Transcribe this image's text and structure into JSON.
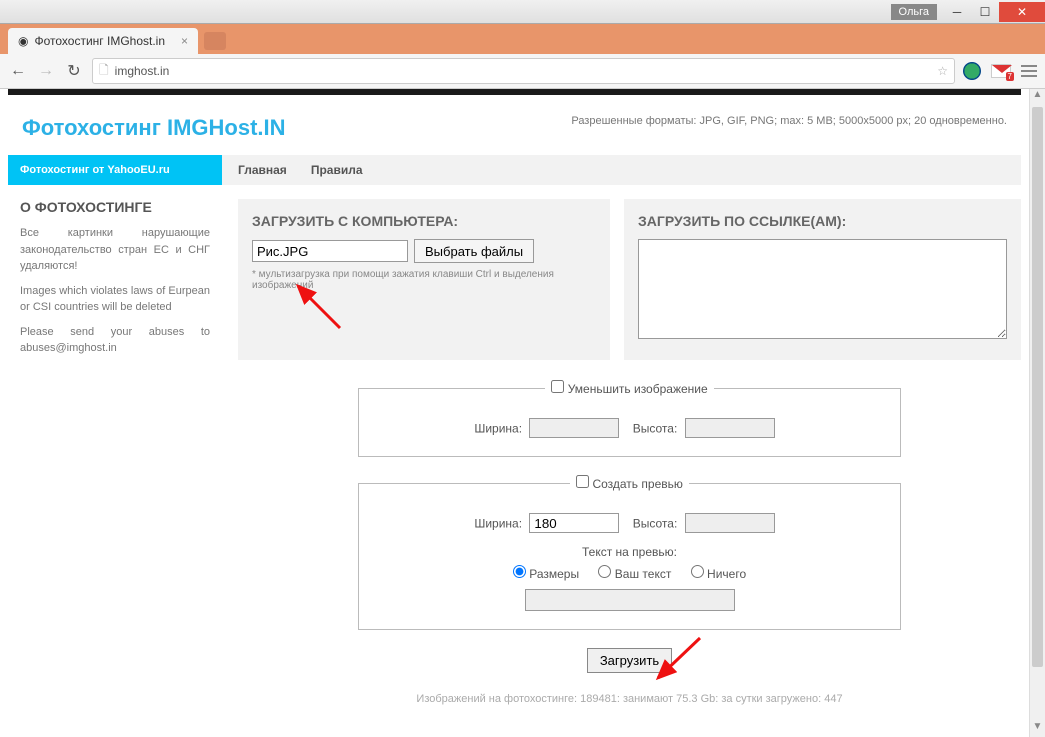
{
  "window": {
    "user": "Ольга"
  },
  "browser": {
    "tab_title": "Фотохостинг IMGhost.in",
    "url": "imghost.in",
    "gmail_badge": "7"
  },
  "header": {
    "site_title": "Фотохостинг IMGHost.IN",
    "allowed": "Разрешенные форматы: JPG, GIF, PNG; max: 5 MB; 5000x5000 px; 20 одновременно."
  },
  "sidebar_header": "Фотохостинг от YahooEU.ru",
  "nav": {
    "home": "Главная",
    "rules": "Правила"
  },
  "sidebar": {
    "title": "О ФОТОХОСТИНГЕ",
    "p1": "Все картинки нарушающие законодательство стран ЕС и СНГ удаляются!",
    "p2": "Images which violates laws of Eurpean or CSI countries will be deleted",
    "p3": "Please send your abuses to abuses@imghost.in"
  },
  "upload": {
    "from_pc_title": "ЗАГРУЗИТЬ С КОМПЬЮТЕРА:",
    "file_value": "Рис.JPG",
    "choose_label": "Выбрать файлы",
    "multi_hint": "* мультизагрузка при помощи зажатия клавиши Ctrl и выделения изображений",
    "from_url_title": "ЗАГРУЗИТЬ ПО ССЫЛКЕ(АМ):"
  },
  "resize": {
    "legend": "Уменьшить изображение",
    "width_label": "Ширина:",
    "height_label": "Высота:",
    "width_value": "",
    "height_value": ""
  },
  "preview": {
    "legend": "Создать превью",
    "width_label": "Ширина:",
    "height_label": "Высота:",
    "width_value": "180",
    "height_value": "",
    "text_label": "Текст на превью:",
    "opt_dims": "Размеры",
    "opt_custom": "Ваш текст",
    "opt_none": "Ничего"
  },
  "submit_label": "Загрузить",
  "footer": "Изображений на фотохостинге: 189481: занимают 75.3 Gb: за сутки загружено: 447"
}
